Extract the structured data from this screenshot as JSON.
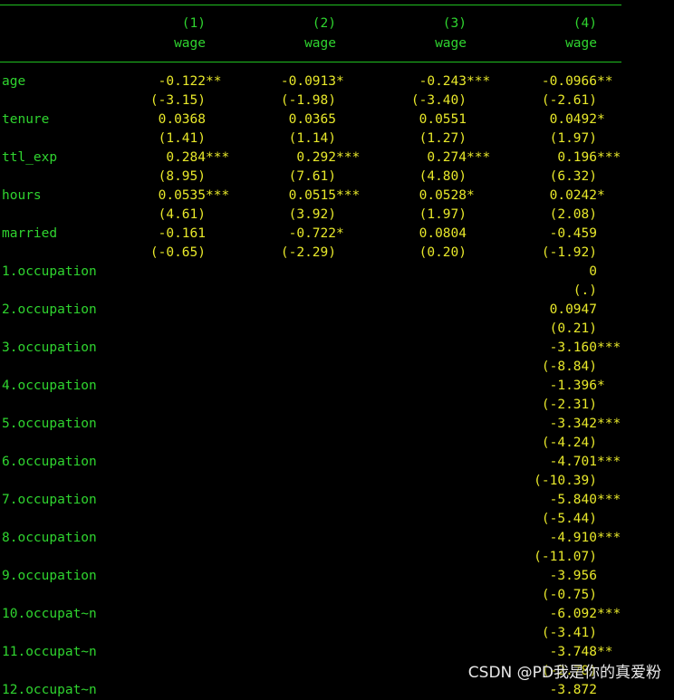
{
  "columns": [
    {
      "num": "(1)",
      "dep": "wage"
    },
    {
      "num": "(2)",
      "dep": "wage"
    },
    {
      "num": "(3)",
      "dep": "wage"
    },
    {
      "num": "(4)",
      "dep": "wage"
    }
  ],
  "rows": [
    {
      "label": "age",
      "coef": [
        "-0.122**",
        "-0.0913*",
        "-0.243***",
        "-0.0966**"
      ],
      "t": [
        "(-3.15)",
        "(-1.98)",
        "(-3.40)",
        "(-2.61)"
      ]
    },
    {
      "label": "tenure",
      "coef": [
        "0.0368",
        "0.0365",
        "0.0551",
        "0.0492*"
      ],
      "t": [
        "(1.41)",
        "(1.14)",
        "(1.27)",
        "(1.97)"
      ]
    },
    {
      "label": "ttl_exp",
      "coef": [
        "0.284***",
        "0.292***",
        "0.274***",
        "0.196***"
      ],
      "t": [
        "(8.95)",
        "(7.61)",
        "(4.80)",
        "(6.32)"
      ]
    },
    {
      "label": "hours",
      "coef": [
        "0.0535***",
        "0.0515***",
        "0.0528*",
        "0.0242*"
      ],
      "t": [
        "(4.61)",
        "(3.92)",
        "(1.97)",
        "(2.08)"
      ]
    },
    {
      "label": "married",
      "coef": [
        "-0.161",
        "-0.722*",
        "0.0804",
        "-0.459"
      ],
      "t": [
        "(-0.65)",
        "(-2.29)",
        "(0.20)",
        "(-1.92)"
      ]
    },
    {
      "label": "1.occupation",
      "coef": [
        "",
        "",
        "",
        "0"
      ],
      "t": [
        "",
        "",
        "",
        "(.)"
      ]
    },
    {
      "label": "2.occupation",
      "coef": [
        "",
        "",
        "",
        "0.0947"
      ],
      "t": [
        "",
        "",
        "",
        "(0.21)"
      ]
    },
    {
      "label": "3.occupation",
      "coef": [
        "",
        "",
        "",
        "-3.160***"
      ],
      "t": [
        "",
        "",
        "",
        "(-8.84)"
      ]
    },
    {
      "label": "4.occupation",
      "coef": [
        "",
        "",
        "",
        "-1.396*"
      ],
      "t": [
        "",
        "",
        "",
        "(-2.31)"
      ]
    },
    {
      "label": "5.occupation",
      "coef": [
        "",
        "",
        "",
        "-3.342***"
      ],
      "t": [
        "",
        "",
        "",
        "(-4.24)"
      ]
    },
    {
      "label": "6.occupation",
      "coef": [
        "",
        "",
        "",
        "-4.701***"
      ],
      "t": [
        "",
        "",
        "",
        "(-10.39)"
      ]
    },
    {
      "label": "7.occupation",
      "coef": [
        "",
        "",
        "",
        "-5.840***"
      ],
      "t": [
        "",
        "",
        "",
        "(-5.44)"
      ]
    },
    {
      "label": "8.occupation",
      "coef": [
        "",
        "",
        "",
        "-4.910***"
      ],
      "t": [
        "",
        "",
        "",
        "(-11.07)"
      ]
    },
    {
      "label": "9.occupation",
      "coef": [
        "",
        "",
        "",
        "-3.956"
      ],
      "t": [
        "",
        "",
        "",
        "(-0.75)"
      ]
    },
    {
      "label": "10.occupat~n",
      "coef": [
        "",
        "",
        "",
        "-6.092***"
      ],
      "t": [
        "",
        "",
        "",
        "(-3.41)"
      ]
    },
    {
      "label": "11.occupat~n",
      "coef": [
        "",
        "",
        "",
        "-3.748**"
      ],
      "t": [
        "",
        "",
        "",
        "(-2.78)"
      ]
    },
    {
      "label": "12.occupat~n",
      "coef": [
        "",
        "",
        "",
        "-3.872"
      ],
      "t": [
        "",
        "",
        "",
        ""
      ]
    }
  ],
  "watermark": "CSDN @PD我是你的真爱粉",
  "colors": {
    "background": "#000000",
    "label_green": "#2fd42f",
    "value_yellow": "#e8e82a",
    "rule_green": "#1fc01f"
  }
}
